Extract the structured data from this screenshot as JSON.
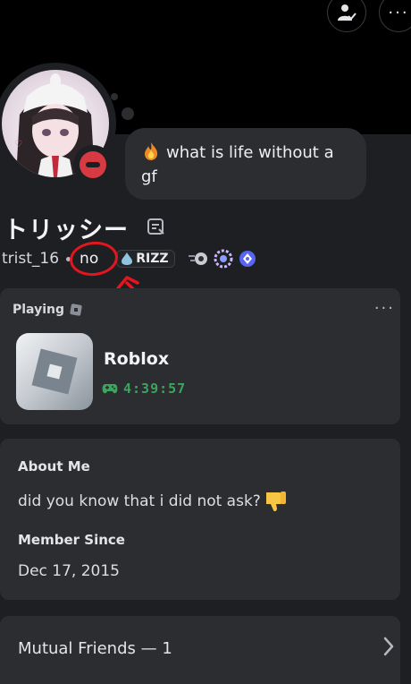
{
  "status_message": {
    "emoji": "fire-emoji",
    "text": "what is life without a gf"
  },
  "profile": {
    "display_name": "トリッシー",
    "username": "trist_16",
    "pronouns": "no",
    "guild_tag": "RIZZ",
    "status": "do-not-disturb"
  },
  "activity": {
    "label": "Playing",
    "game": "Roblox",
    "elapsed": "4:39:57",
    "more_label": "···"
  },
  "about": {
    "title": "About Me",
    "text": "did you know that i did not ask?",
    "emoji": "thumbs-down-emoji"
  },
  "member_since": {
    "title": "Member Since",
    "date": "Dec 17, 2015"
  },
  "mutual_friends": {
    "label": "Mutual Friends — 1"
  },
  "colors": {
    "background": "#1e1f23",
    "card": "#2b2d31",
    "dnd_red": "#d83a42",
    "timer_green": "#3ba55c",
    "annotation_red": "#e3161f"
  }
}
